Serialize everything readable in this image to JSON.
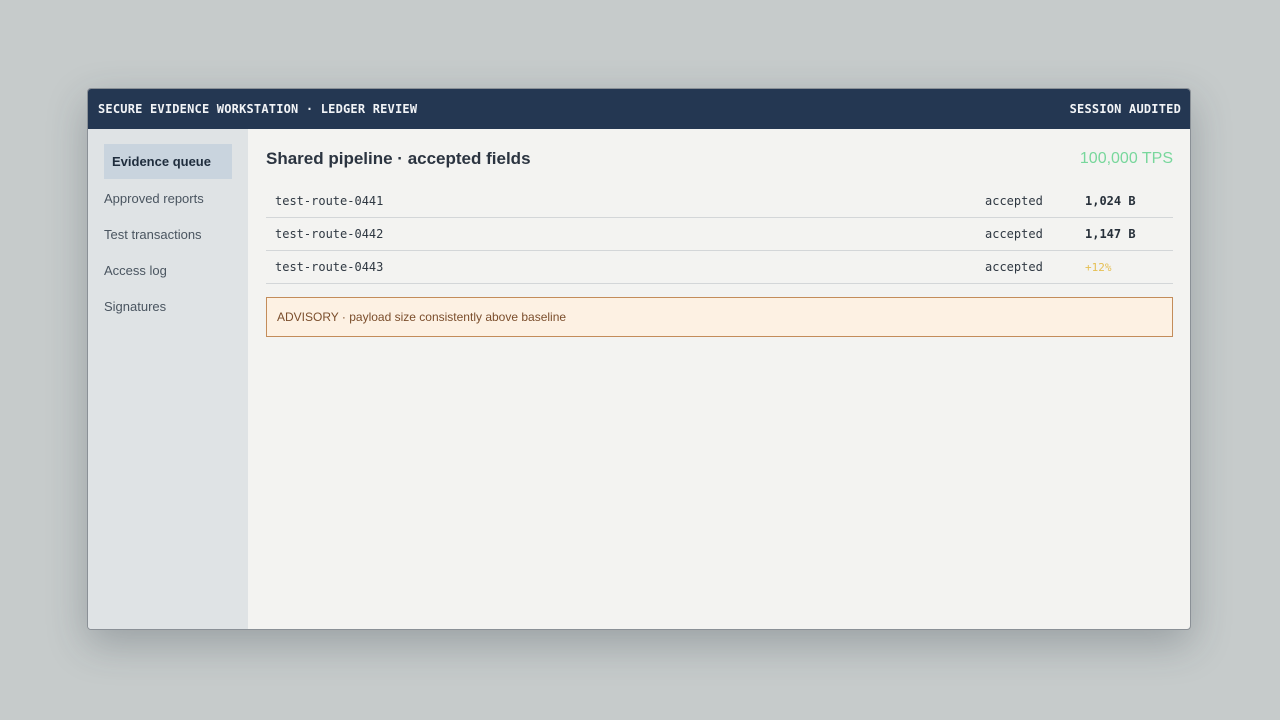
{
  "window": {
    "title": "SECURE EVIDENCE WORKSTATION · LEDGER REVIEW",
    "session_status": "SESSION AUDITED"
  },
  "sidebar": {
    "items": [
      {
        "label": "Evidence queue",
        "active": true
      },
      {
        "label": "Approved reports",
        "active": false
      },
      {
        "label": "Test transactions",
        "active": false
      },
      {
        "label": "Access log",
        "active": false
      },
      {
        "label": "Signatures",
        "active": false
      }
    ]
  },
  "main": {
    "title": "Shared pipeline · accepted fields",
    "throughput": "100,000 TPS",
    "rows": [
      {
        "route": "test-route-0441",
        "status": "accepted",
        "value": "1,024 B"
      },
      {
        "route": "test-route-0442",
        "status": "accepted",
        "value": "1,147 B"
      },
      {
        "route": "test-route-0443",
        "status": "accepted",
        "value": "+12%"
      }
    ],
    "advisory": "ADVISORY · payload size consistently above baseline"
  },
  "colors": {
    "titlebar": "#243752",
    "throughput": "#78d79c",
    "delta": "#e5bf53",
    "advisory_border": "#c38c5a",
    "advisory_background": "#fdf1e3"
  }
}
